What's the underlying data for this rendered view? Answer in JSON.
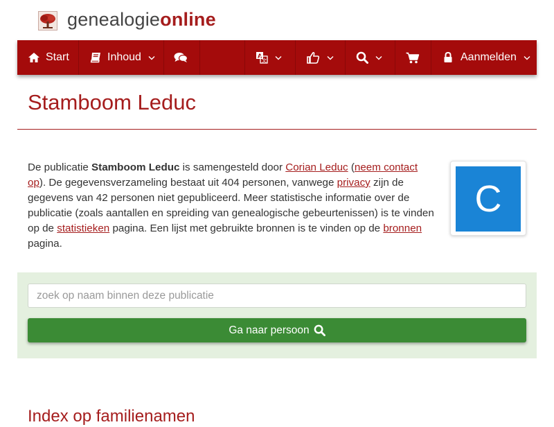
{
  "header": {
    "logo_part1": "genealogie",
    "logo_part2": "online"
  },
  "nav": {
    "start_label": "Start",
    "contents_label": "Inhoud",
    "login_label": "Aanmelden",
    "icons": [
      "home-icon",
      "book-icon",
      "comments-icon",
      "language-icon",
      "thumbs-up-icon",
      "search-icon",
      "cart-icon",
      "lock-icon"
    ]
  },
  "page": {
    "title": "Stamboom Leduc"
  },
  "intro": {
    "t1": "De publicatie ",
    "pub_name": "Stamboom Leduc",
    "t2": " is samengesteld door ",
    "author_link": "Corian Leduc",
    "t3": " (",
    "contact_link": "neem contact op",
    "t4": "). De gegevensverzameling bestaat uit 404 personen, vanwege ",
    "privacy_link": "privacy",
    "t5": " zijn de gegevens van 42 personen niet gepubliceerd. Meer statistische informatie over de publicatie (zoals aantallen en spreiding van genealogische gebeurtenissen) is te vinden op de ",
    "stats_link": "statistieken",
    "t6": " pagina. Een lijst met gebruikte bronnen is te vinden op de ",
    "sources_link": "bronnen",
    "t7": " pagina."
  },
  "avatar": {
    "letter": "C",
    "color": "#1a84d6"
  },
  "search": {
    "placeholder": "zoek op naam binnen deze publicatie",
    "value": "",
    "button_label": "Ga naar persoon"
  },
  "section": {
    "heading": "Index op familienamen"
  },
  "colors": {
    "brand": "#a40b0b",
    "link": "#a51d1d",
    "panel": "#e4f0df",
    "button": "#3b8b35"
  }
}
